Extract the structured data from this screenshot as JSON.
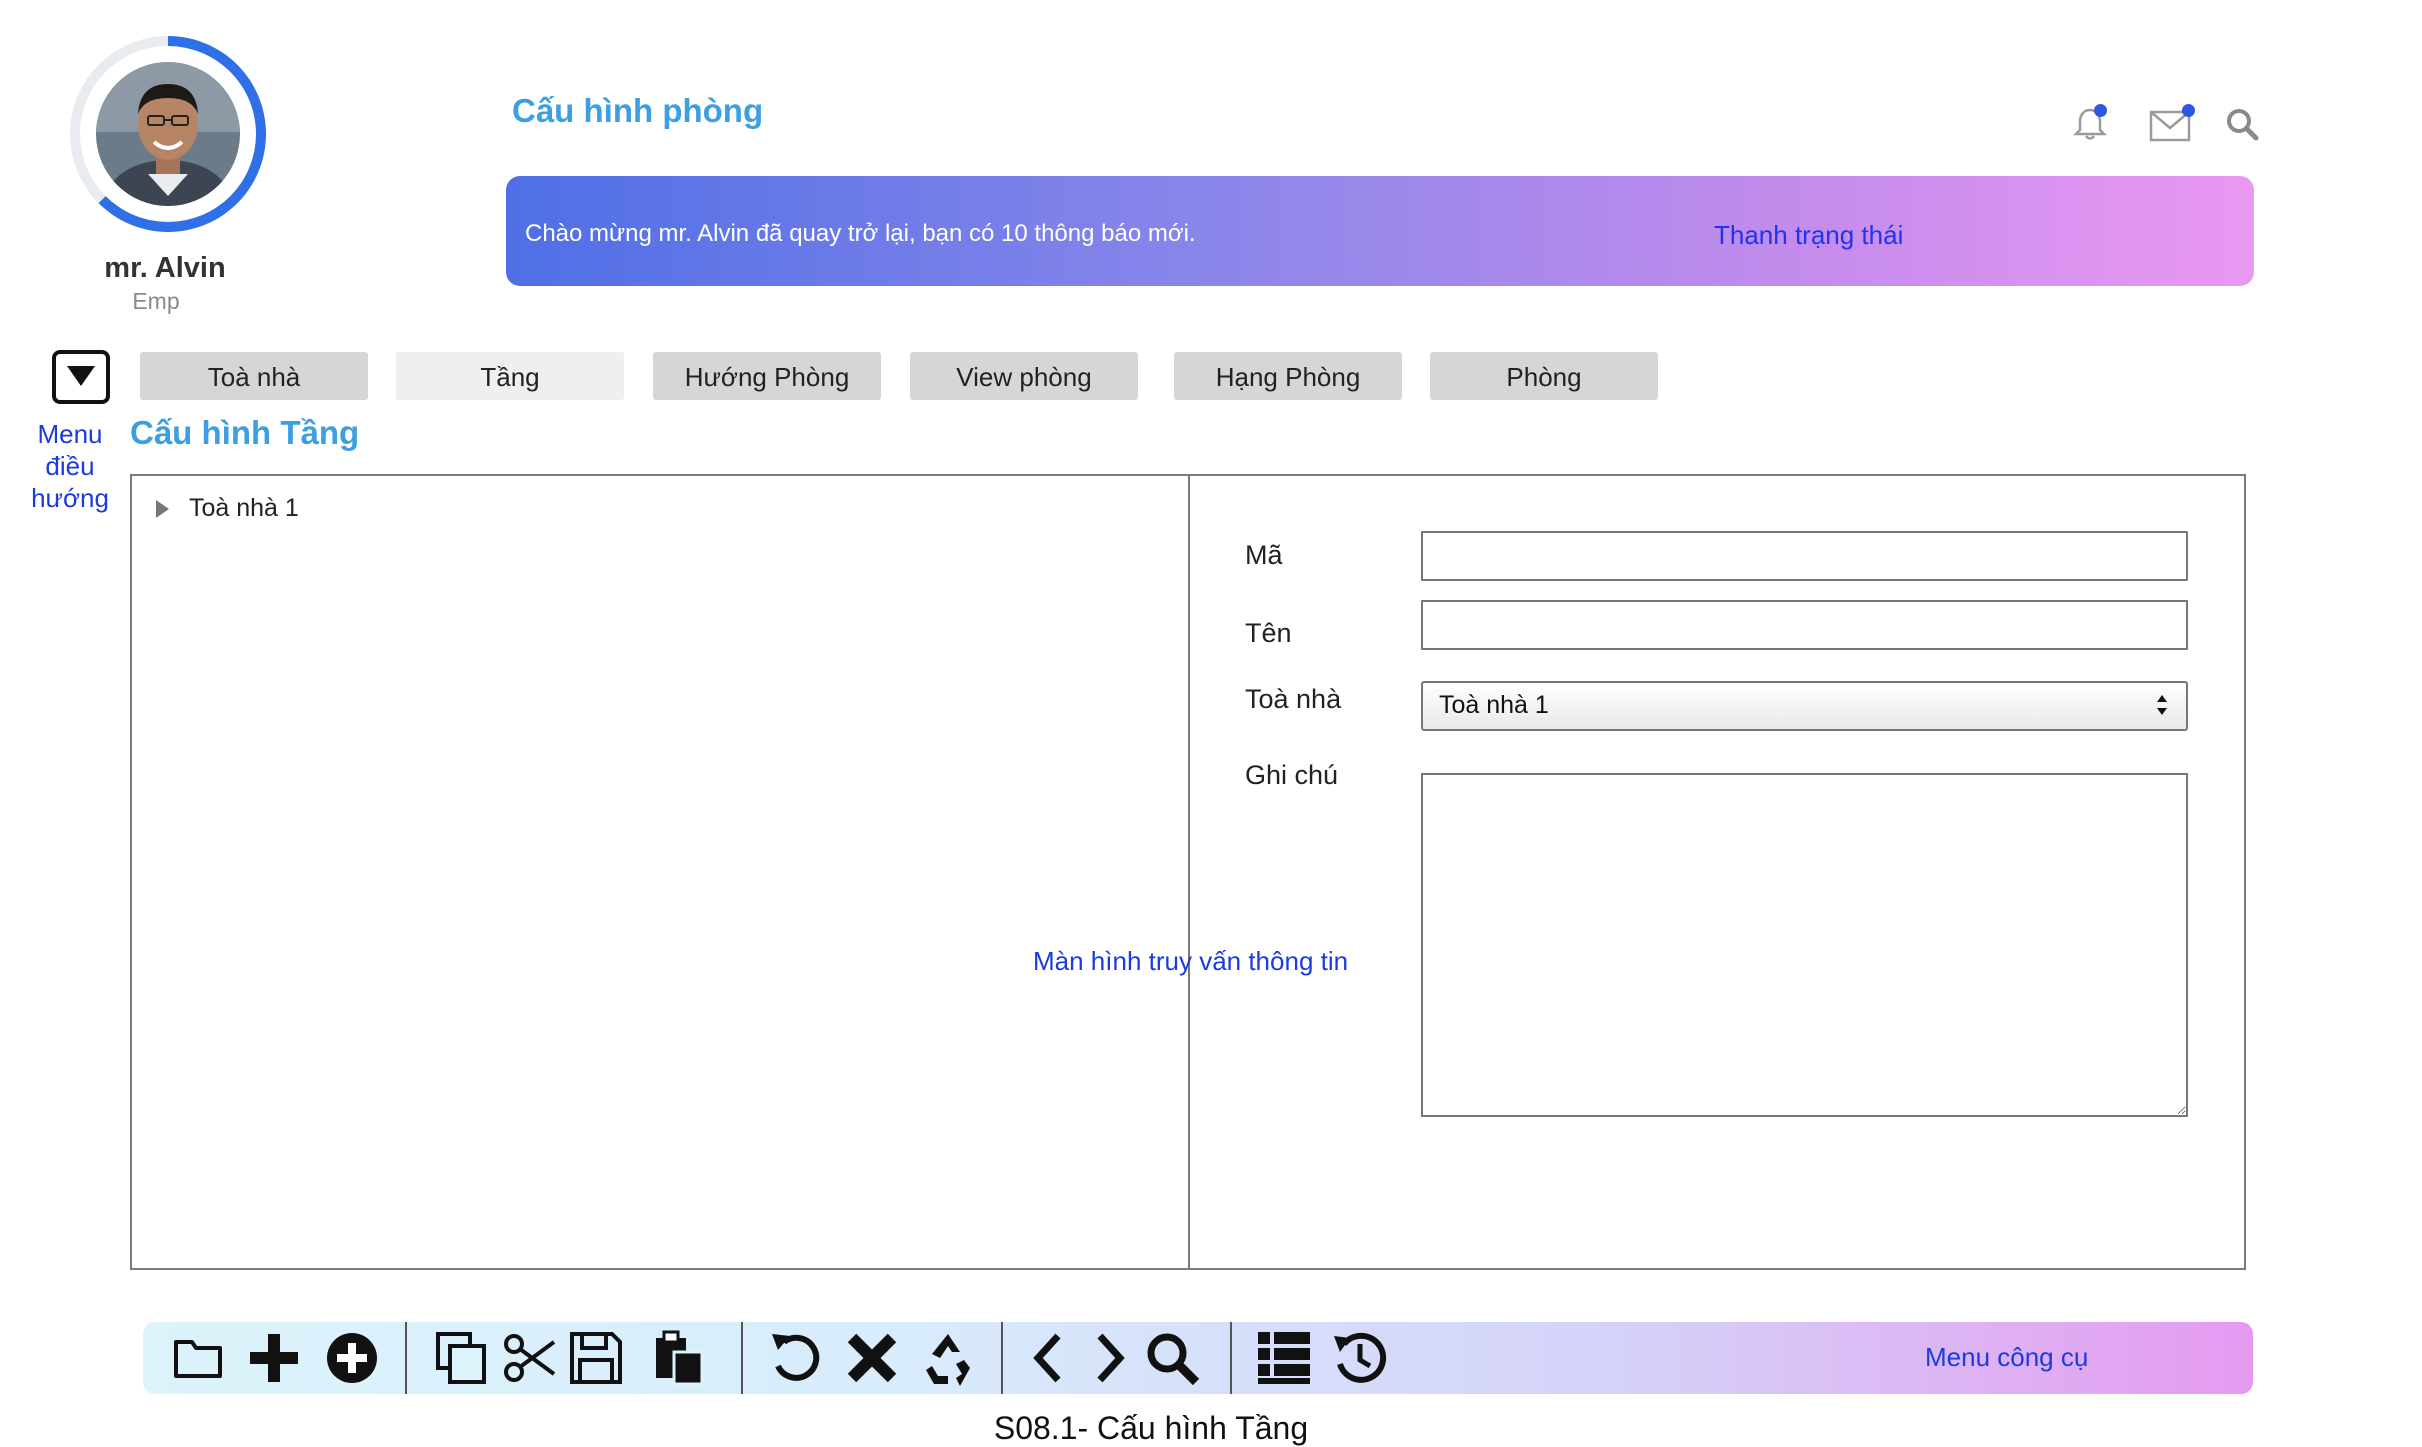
{
  "header": {
    "page_title": "Cấu hình phòng",
    "user": {
      "name": "mr. Alvin",
      "role": "Emp"
    },
    "icons": [
      "bell-icon",
      "mail-icon",
      "search-icon"
    ],
    "banner": {
      "message": "Chào mừng mr. Alvin đã quay trở lại, bạn có 10 thông báo mới.",
      "status_label": "Thanh trạng thái"
    }
  },
  "nav": {
    "menu_label": "Menu điều hướng",
    "tabs": [
      {
        "label": "Toà nhà"
      },
      {
        "label": "Tầng"
      },
      {
        "label": "Hướng Phòng"
      },
      {
        "label": "View phòng"
      },
      {
        "label": "Hạng Phòng"
      },
      {
        "label": "Phòng"
      }
    ]
  },
  "section": {
    "title": "Cấu hình Tầng"
  },
  "tree": {
    "items": [
      {
        "label": "Toà nhà 1"
      }
    ]
  },
  "form": {
    "code_label": "Mã",
    "code_value": "",
    "name_label": "Tên",
    "name_value": "",
    "building_label": "Toà nhà",
    "building_value": "Toà nhà 1",
    "note_label": "Ghi chú",
    "note_value": ""
  },
  "query_label": "Màn hình truy vấn thông tin",
  "toolbar": {
    "label": "Menu công cụ",
    "icons": [
      "folder-icon",
      "plus-icon",
      "add-circle-icon",
      "copy-icon",
      "cut-icon",
      "save-icon",
      "paste-icon",
      "undo-icon",
      "delete-icon",
      "recycle-icon",
      "prev-icon",
      "next-icon",
      "search-icon",
      "list-icon",
      "history-icon"
    ]
  },
  "caption": "S08.1- Cấu hình Tầng",
  "colors": {
    "accent": "#3b9fe0",
    "link": "#1a3be0",
    "banner_start": "#4f6fe6",
    "banner_end": "#ea98f2"
  }
}
